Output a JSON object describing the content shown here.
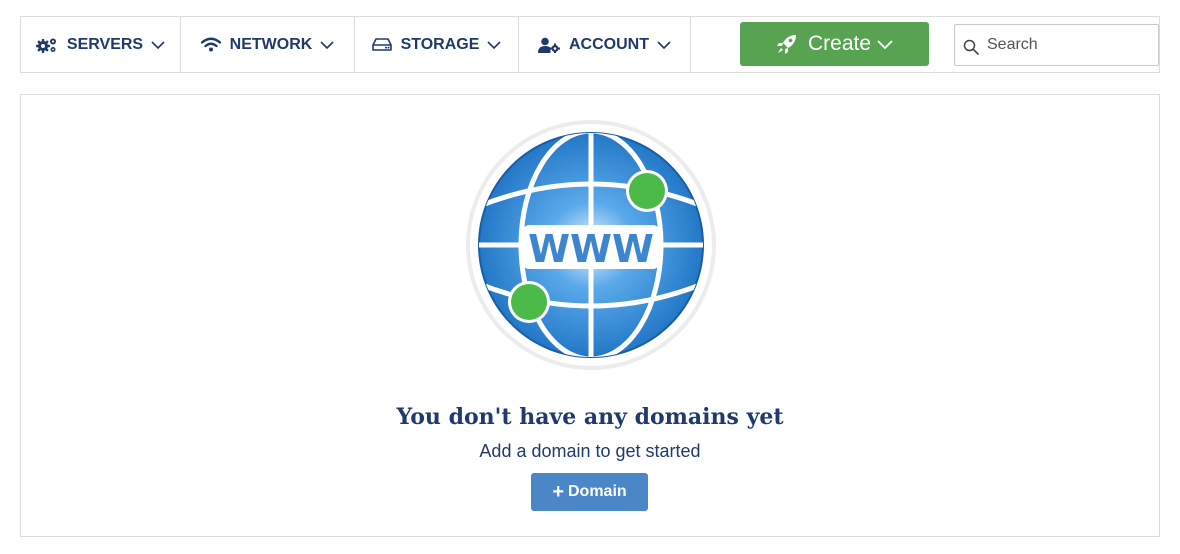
{
  "nav": {
    "items": [
      {
        "label": "SERVERS",
        "icon": "gears-icon"
      },
      {
        "label": "NETWORK",
        "icon": "wifi-icon"
      },
      {
        "label": "STORAGE",
        "icon": "hard-drive-icon"
      },
      {
        "label": "ACCOUNT",
        "icon": "user-cog-icon"
      }
    ],
    "create_label": "Create",
    "search_placeholder": "Search"
  },
  "empty_state": {
    "illustration_text": "WWW",
    "title": "You don't have any domains yet",
    "subtitle": "Add a domain to get started",
    "button_plus": "+",
    "button_label": "Domain"
  },
  "colors": {
    "nav_text": "#1f3a6b",
    "create_button": "#58a352",
    "add_button": "#4b87c6",
    "globe_blue": "#2a7fd0",
    "node_green": "#4cba48"
  }
}
